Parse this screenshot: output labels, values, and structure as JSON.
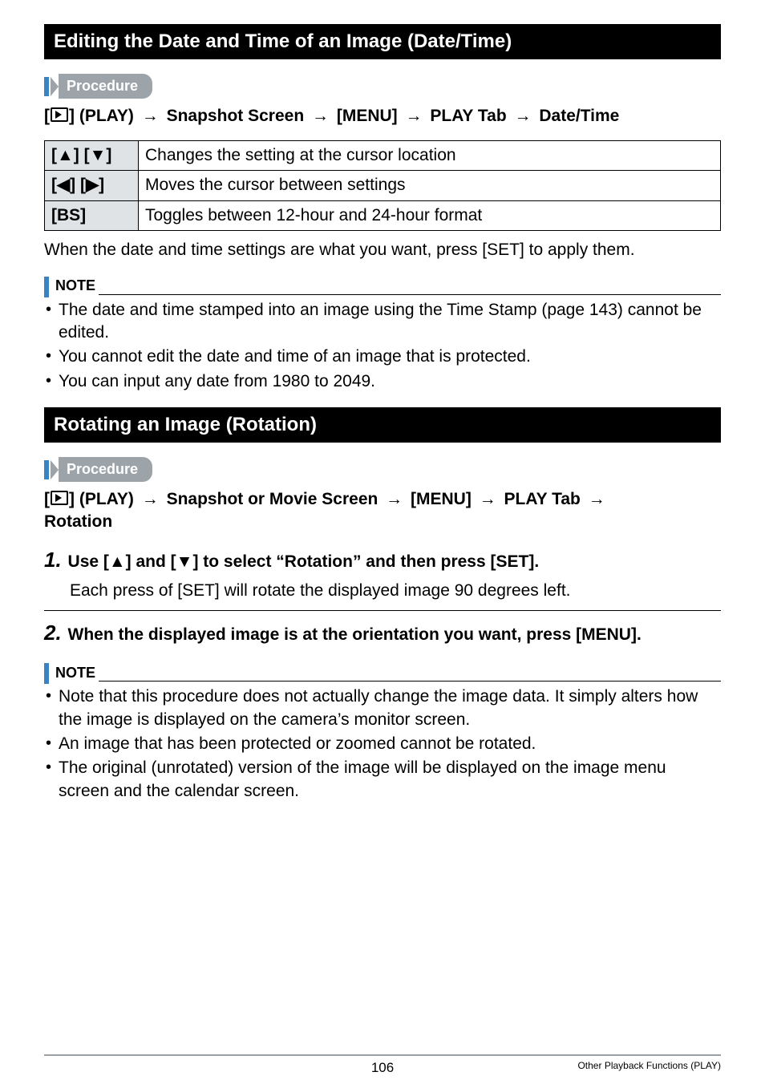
{
  "heading1": "Editing the Date and Time of an Image (Date/Time)",
  "procedure_label": "Procedure",
  "breadcrumb1": {
    "prefix": "[",
    "play_word": "] (PLAY)",
    "s1": "Snapshot Screen",
    "s2": "[MENU]",
    "s3": "PLAY Tab",
    "s4": "Date/Time"
  },
  "key_table": [
    {
      "keys": "[▲] [▼]",
      "desc": "Changes the setting at the cursor location"
    },
    {
      "keys": "[◀] [▶]",
      "desc": "Moves the cursor between settings"
    },
    {
      "keys": "[BS]",
      "desc": "Toggles between 12-hour and 24-hour format"
    }
  ],
  "after_table": "When the date and time settings are what you want, press [SET] to apply them.",
  "note_label": "NOTE",
  "note1_items": [
    "The date and time stamped into an image using the Time Stamp (page 143) cannot be edited.",
    "You cannot edit the date and time of an image that is protected.",
    "You can input any date from 1980 to 2049."
  ],
  "heading2": "Rotating an Image (Rotation)",
  "breadcrumb2": {
    "prefix": "[",
    "play_word": "] (PLAY)",
    "s1": "Snapshot or Movie Screen",
    "s2": "[MENU]",
    "s3": "PLAY Tab",
    "s4": "Rotation"
  },
  "steps": [
    {
      "num": "1.",
      "title": "Use [▲] and [▼] to select “Rotation” and then press [SET].",
      "body": "Each press of [SET] will rotate the displayed image 90 degrees left."
    },
    {
      "num": "2.",
      "title": "When the displayed image is at the orientation you want, press [MENU].",
      "body": ""
    }
  ],
  "note2_items": [
    "Note that this procedure does not actually change the image data. It simply alters how the image is displayed on the camera’s monitor screen.",
    "An image that has been protected or zoomed cannot be rotated.",
    "The original (unrotated) version of the image will be displayed on the image menu screen and the calendar screen."
  ],
  "footer": {
    "page": "106",
    "right": "Other Playback Functions (PLAY)"
  }
}
